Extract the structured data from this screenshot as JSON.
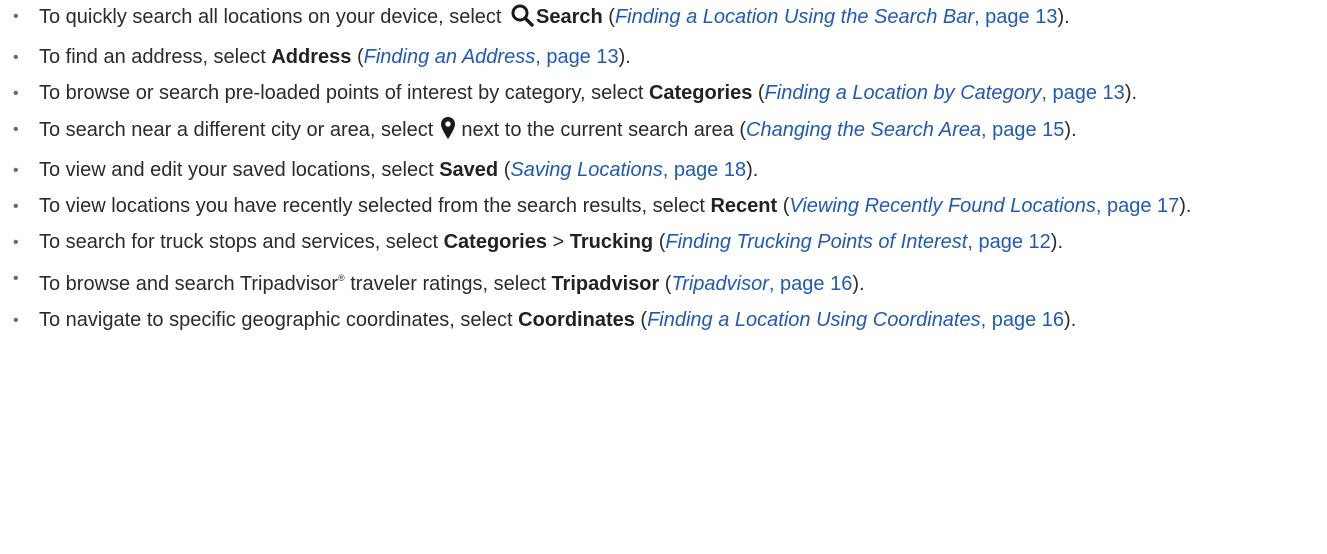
{
  "items": [
    {
      "prefix": "To quickly search all locations on your device, select ",
      "icon": "search-icon",
      "bold": "Search",
      "open": " (",
      "link_title": "Finding a Location Using the Search Bar",
      "link_page": ", page 13",
      "close": ")."
    },
    {
      "prefix": "To find an address, select ",
      "bold": "Address",
      "open": " (",
      "link_title": "Finding an Address",
      "link_page": ", page 13",
      "close": ")."
    },
    {
      "prefix": "To browse or search pre-loaded points of interest by category, select ",
      "bold": "Categories",
      "open": " (",
      "link_title": "Finding a Location by Category",
      "link_page": ", page 13",
      "close": ")."
    },
    {
      "prefix": "To search near a different city or area, select ",
      "icon": "map-pin-icon",
      "suffix": " next to the current search area (",
      "link_title": "Changing the Search Area",
      "link_page": ", page 15",
      "close": ")."
    },
    {
      "prefix": "To view and edit your saved locations, select ",
      "bold": "Saved",
      "open": " (",
      "link_title": "Saving Locations",
      "link_page": ", page 18",
      "close": ")."
    },
    {
      "prefix": "To view locations you have recently selected from the search results, select ",
      "bold": "Recent",
      "open": " (",
      "link_title": "Viewing Recently Found Locations",
      "link_page": ", page 17",
      "close": ")."
    },
    {
      "prefix": "To search for truck stops and services, select ",
      "bold": "Categories",
      "sep": " > ",
      "bold2": "Trucking",
      "open": " (",
      "link_title": "Finding Trucking Points of Interest",
      "link_page": ", page 12",
      "close": ")."
    },
    {
      "prefix": "To browse and search Tripadvisor",
      "reg": "®",
      "prefix2": " traveler ratings, select ",
      "bold": "Tripadvisor",
      "open": " (",
      "link_title": "Tripadvisor",
      "link_page": ", page 16",
      "close": ")."
    },
    {
      "prefix": "To navigate to specific geographic coordinates, select ",
      "bold": "Coordinates",
      "open": " (",
      "link_title": "Finding a Location Using Coordinates",
      "link_page": ", page 16",
      "close": ")."
    }
  ],
  "bullet": "•",
  "colors": {
    "text": "#2b2b2b",
    "link": "#1f5ab5",
    "bullet": "#6a6a6a"
  }
}
